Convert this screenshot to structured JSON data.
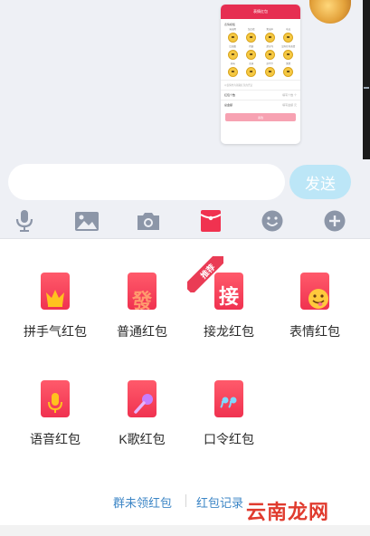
{
  "composer": {
    "input_value": "",
    "send_label": "发送"
  },
  "toolbar": [
    "microphone-icon",
    "image-icon",
    "camera-icon",
    "red-packet-icon",
    "emoji-icon",
    "plus-icon"
  ],
  "chat_preview": {
    "header_title": "表情红包",
    "section_label": "表情模板",
    "emoji_tags": [
      "玩出风",
      "加点戏",
      "笑出声",
      "吃瓜",
      "比较酷",
      "得瑟",
      "超灵巧",
      "没有任何表情",
      "天呐",
      "卖萌",
      "放不下",
      "笑脸"
    ],
    "note": "以表情作为领取红包的凭证",
    "rows": [
      {
        "label": "红包个数",
        "hint": "填写个数 个"
      },
      {
        "label": "总金额",
        "hint": "填写金额 元"
      }
    ],
    "button_label": "塞钱"
  },
  "packets": [
    {
      "label": "拼手气红包",
      "icon": "crown-icon"
    },
    {
      "label": "普通红包",
      "icon": "fortune-character-icon",
      "glyph": "發"
    },
    {
      "label": "接龙红包",
      "icon": "relay-character-icon",
      "glyph": "接",
      "badge": "推荐"
    },
    {
      "label": "表情红包",
      "icon": "smiley-face-icon"
    },
    {
      "label": "语音红包",
      "icon": "voice-mic-icon"
    },
    {
      "label": "K歌红包",
      "icon": "karaoke-mic-icon"
    },
    {
      "label": "口令红包",
      "icon": "quote-icon"
    }
  ],
  "footer": {
    "unclaimed": "群未领红包",
    "history": "红包记录"
  },
  "watermark": "云南龙网",
  "colors": {
    "accent_red": "#f03250",
    "send_button": "#bce6f7",
    "link_blue": "#3d86c6",
    "icon_gray": "#8c96a8"
  }
}
